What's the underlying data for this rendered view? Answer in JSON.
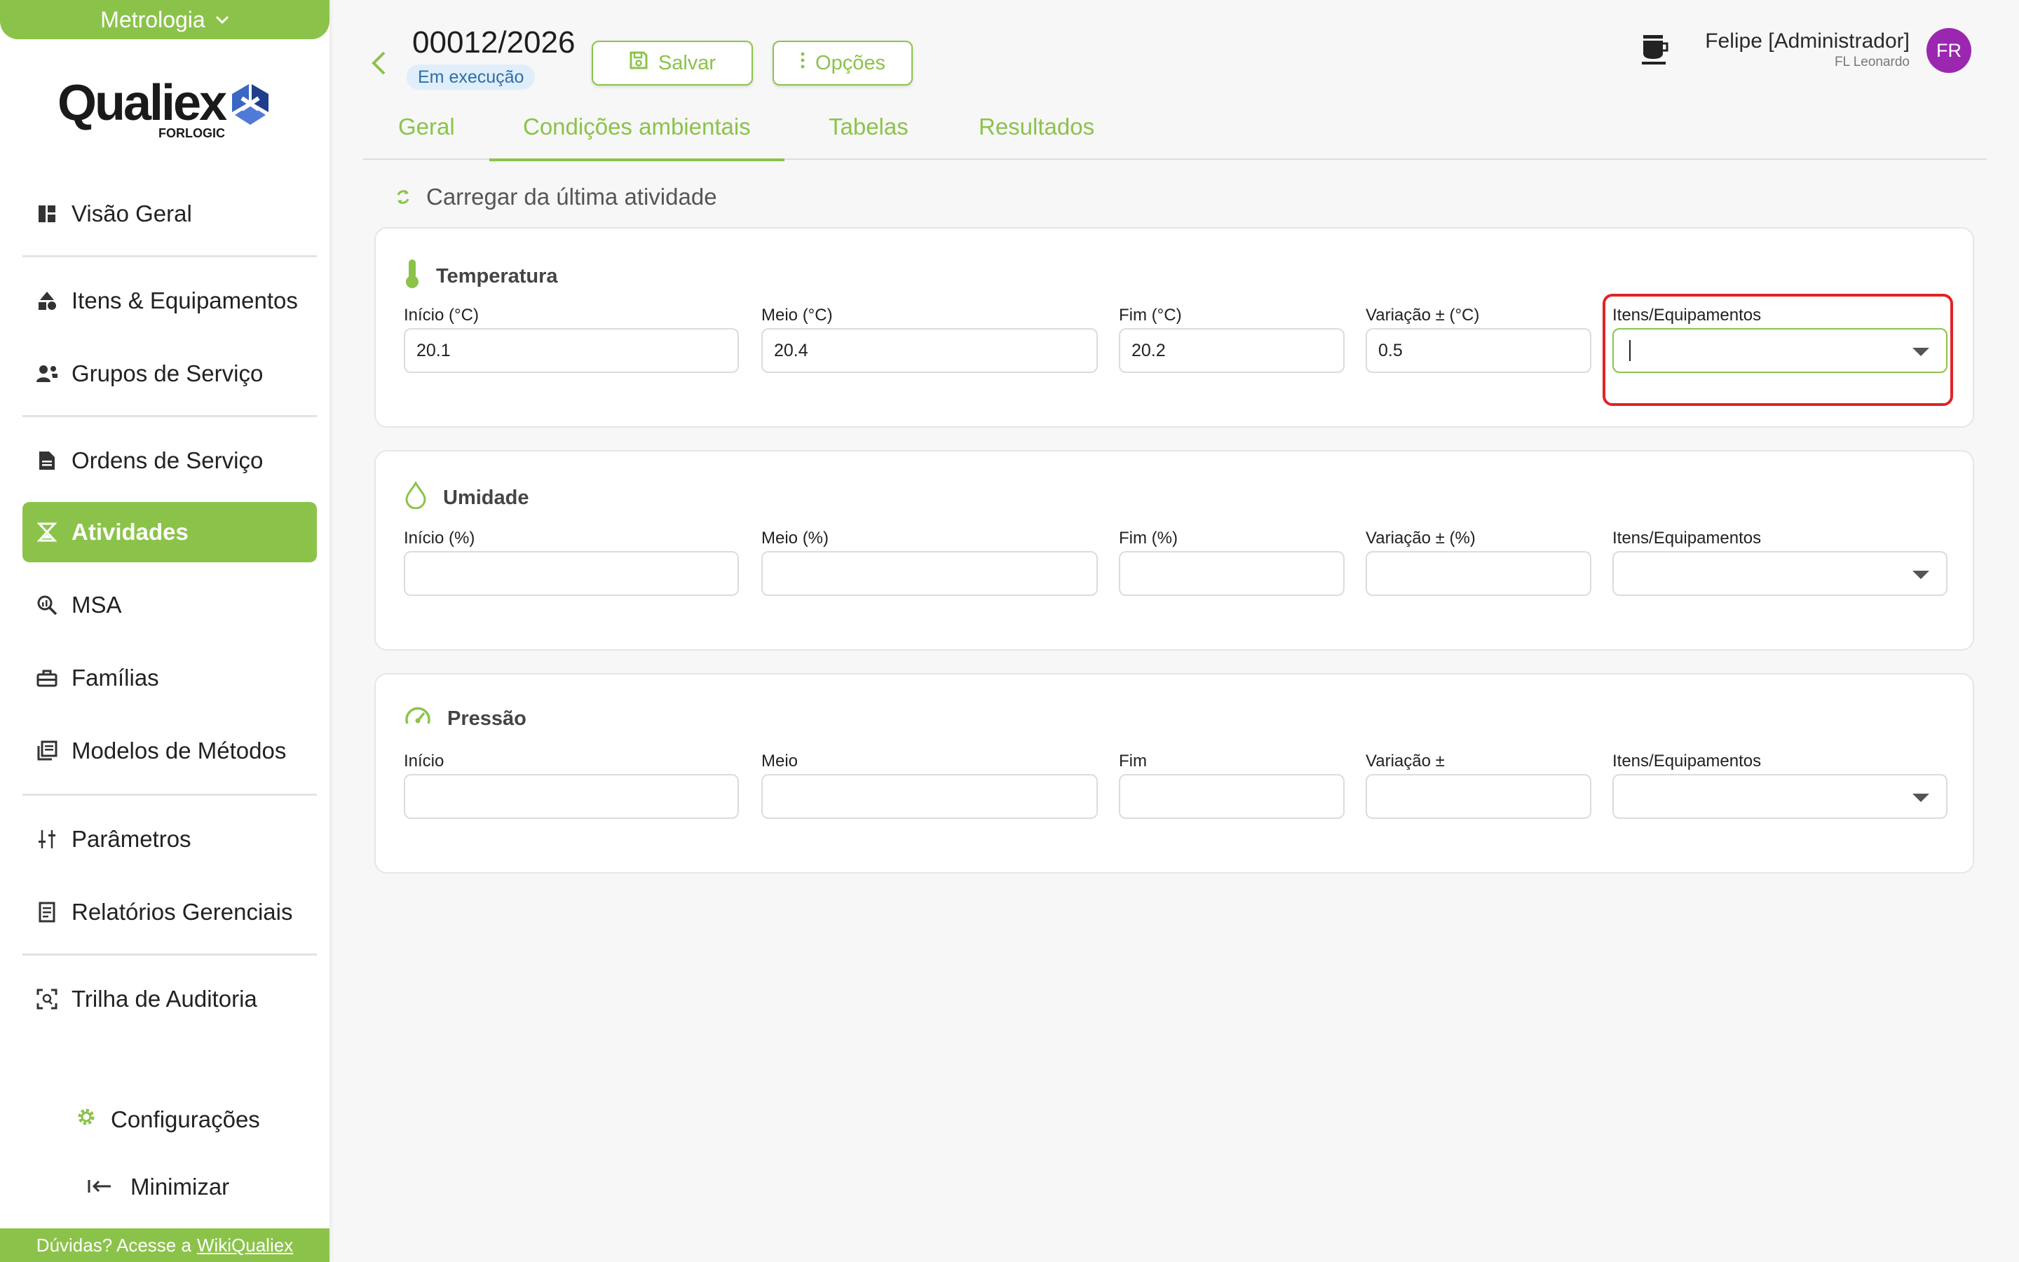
{
  "sidebar": {
    "module": "Metrologia",
    "logo": {
      "word": "Qualiex",
      "sub": "FORLOGIC"
    },
    "items": [
      {
        "label": "Visão Geral",
        "icon": "dashboard-icon"
      },
      {
        "label": "Itens & Equipamentos",
        "icon": "shapes-icon"
      },
      {
        "label": "Grupos de Serviço",
        "icon": "user-group-icon"
      },
      {
        "label": "Ordens de Serviço",
        "icon": "document-icon"
      },
      {
        "label": "Atividades",
        "icon": "hourglass-icon"
      },
      {
        "label": "MSA",
        "icon": "magnify-chart-icon"
      },
      {
        "label": "Famílias",
        "icon": "toolbox-icon"
      },
      {
        "label": "Modelos de Métodos",
        "icon": "library-icon"
      },
      {
        "label": "Parâmetros",
        "icon": "sliders-icon"
      },
      {
        "label": "Relatórios Gerenciais",
        "icon": "report-icon"
      },
      {
        "label": "Trilha de Auditoria",
        "icon": "audit-scan-icon"
      }
    ],
    "settings_label": "Configurações",
    "minimize_label": "Minimizar",
    "help_prefix": "Dúvidas? Acesse a",
    "help_link": "WikiQualiex"
  },
  "header": {
    "os_number": "00012/2026",
    "status": "Em execução",
    "save_label": "Salvar",
    "options_label": "Opções",
    "user_name": "Felipe [Administrador]",
    "user_org": "FL Leonardo",
    "avatar_initials": "FR"
  },
  "tabs": [
    {
      "label": "Geral"
    },
    {
      "label": "Condições ambientais",
      "active": true
    },
    {
      "label": "Tabelas"
    },
    {
      "label": "Resultados"
    }
  ],
  "load_last_label": "Carregar da última atividade",
  "sections": {
    "temperature": {
      "title": "Temperatura",
      "start_label": "Início (°C)",
      "start_value": "20.1",
      "middle_label": "Meio (°C)",
      "middle_value": "20.4",
      "end_label": "Fim (°C)",
      "end_value": "20.2",
      "variation_label": "Variação ± (°C)",
      "variation_value": "0.5",
      "equipment_label": "Itens/Equipamentos",
      "equipment_value": ""
    },
    "humidity": {
      "title": "Umidade",
      "start_label": "Início (%)",
      "start_value": "",
      "middle_label": "Meio (%)",
      "middle_value": "",
      "end_label": "Fim (%)",
      "end_value": "",
      "variation_label": "Variação ± (%)",
      "variation_value": "",
      "equipment_label": "Itens/Equipamentos",
      "equipment_value": ""
    },
    "pressure": {
      "title": "Pressão",
      "start_label": "Início",
      "start_value": "",
      "middle_label": "Meio",
      "middle_value": "",
      "end_label": "Fim",
      "end_value": "",
      "variation_label": "Variação ±",
      "variation_value": "",
      "equipment_label": "Itens/Equipamentos",
      "equipment_value": ""
    }
  },
  "colors": {
    "accent": "#8bc34a",
    "highlight": "#e02424",
    "avatar": "#9b27b0",
    "status_bg": "#dfeefa"
  }
}
